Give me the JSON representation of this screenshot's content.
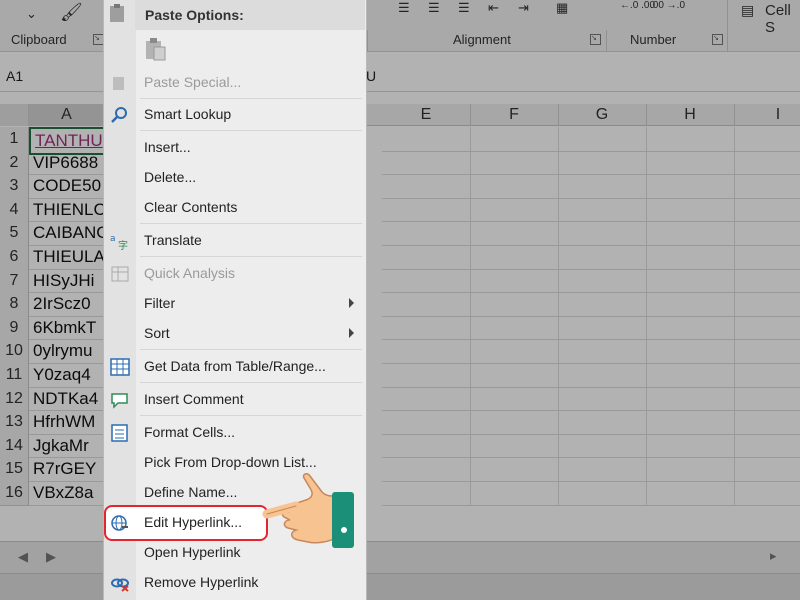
{
  "ribbon": {
    "groups": [
      "Clipboard",
      "Alignment",
      "Number"
    ],
    "cell_styles_fragment": "Cell S"
  },
  "formula_bar": {
    "name_box": "A1",
    "content_fragment": "U"
  },
  "sheet": {
    "columns": [
      "A",
      "E",
      "F",
      "G",
      "H",
      "I"
    ],
    "rows": [
      {
        "num": "1",
        "a": "TANTHU"
      },
      {
        "num": "2",
        "a": "VIP6688"
      },
      {
        "num": "3",
        "a": "CODE50"
      },
      {
        "num": "4",
        "a": "THIENLC"
      },
      {
        "num": "5",
        "a": "CAIBANG"
      },
      {
        "num": "6",
        "a": "THIEULA"
      },
      {
        "num": "7",
        "a": "HISyJHi"
      },
      {
        "num": "8",
        "a": "2IrScz0"
      },
      {
        "num": "9",
        "a": "6KbmkT"
      },
      {
        "num": "10",
        "a": "0ylrymu"
      },
      {
        "num": "11",
        "a": "Y0zaq4"
      },
      {
        "num": "12",
        "a": "NDTKa4"
      },
      {
        "num": "13",
        "a": "HfrhWM"
      },
      {
        "num": "14",
        "a": "JgkaMr"
      },
      {
        "num": "15",
        "a": "R7rGEY"
      },
      {
        "num": "16",
        "a": "VBxZ8a"
      }
    ]
  },
  "context_menu": {
    "paste_options_header": "Paste Options:",
    "items": [
      {
        "label": "Paste Special...",
        "icon": "paste-special-icon",
        "disabled": true
      },
      {
        "label": "Smart Lookup",
        "icon": "search-icon",
        "disabled": false
      },
      {
        "label": "Insert...",
        "icon": "",
        "disabled": false
      },
      {
        "label": "Delete...",
        "icon": "",
        "disabled": false
      },
      {
        "label": "Clear Contents",
        "icon": "",
        "disabled": false
      },
      {
        "label": "Translate",
        "icon": "translate-icon",
        "disabled": false
      },
      {
        "label": "Quick Analysis",
        "icon": "quick-analysis-icon",
        "disabled": true
      },
      {
        "label": "Filter",
        "icon": "",
        "disabled": false,
        "submenu": true
      },
      {
        "label": "Sort",
        "icon": "",
        "disabled": false,
        "submenu": true
      },
      {
        "label": "Get Data from Table/Range...",
        "icon": "table-icon",
        "disabled": false
      },
      {
        "label": "Insert Comment",
        "icon": "comment-icon",
        "disabled": false
      },
      {
        "label": "Format Cells...",
        "icon": "format-cells-icon",
        "disabled": false
      },
      {
        "label": "Pick From Drop-down List...",
        "icon": "",
        "disabled": false
      },
      {
        "label": "Define Name...",
        "icon": "",
        "disabled": false
      },
      {
        "label": "Edit Hyperlink...",
        "icon": "hyperlink-icon",
        "disabled": false,
        "highlighted": true
      },
      {
        "label": "Open Hyperlink",
        "icon": "",
        "disabled": false
      },
      {
        "label": "Remove Hyperlink",
        "icon": "remove-hyperlink-icon",
        "disabled": false
      }
    ]
  },
  "colors": {
    "highlight_border": "#e2262e",
    "hand_skin": "#f6c391",
    "hand_cuff": "#1c8f79",
    "row1_text": "#a0357b"
  }
}
